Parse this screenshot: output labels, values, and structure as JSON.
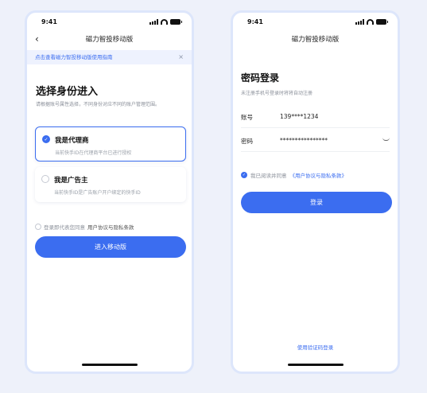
{
  "colors": {
    "accent": "#3b6df0",
    "background": "#eef1fa",
    "banner_bg": "#eef2fe"
  },
  "left": {
    "status_time": "9:41",
    "nav_title": "磁力智投移动版",
    "banner_text": "点击查看磁力智投移动版使用指南",
    "banner_close": "×",
    "heading": "选择身份进入",
    "subheading": "请根据账号属性选择，不同身份对应不同的账户管理范围。",
    "roles": [
      {
        "title": "我是代理商",
        "desc": "当前快手ID在代理商平台已进行授权",
        "selected": true
      },
      {
        "title": "我是广告主",
        "desc": "当前快手ID是广告账户开户绑定的快手ID",
        "selected": false
      }
    ],
    "agreement_prefix": "登录即代表您同意",
    "agreement_link": "用户协议与隐私条款",
    "enter_button": "进入移动版"
  },
  "right": {
    "status_time": "9:41",
    "nav_title": "磁力智投移动版",
    "heading": "密码登录",
    "subheading": "未注册手机号登录时将将自动注册",
    "account_label": "账号",
    "account_value": "139****1234",
    "password_label": "密码",
    "password_value": "****************",
    "agreement_prefix": "我已阅读并同意",
    "agreement_link": "《用户协议与隐私条款》",
    "login_button": "登录",
    "alt_login": "使用验证码登录"
  }
}
